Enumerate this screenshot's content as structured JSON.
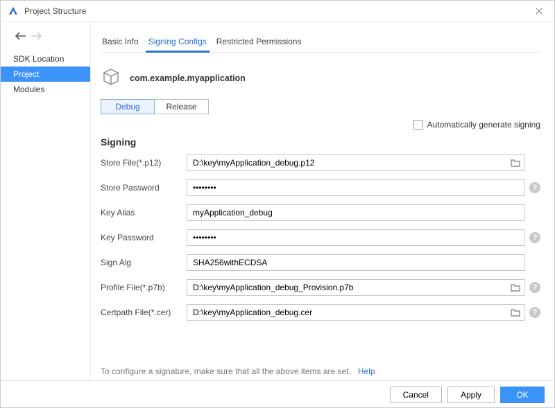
{
  "window": {
    "title": "Project Structure"
  },
  "sidebar": {
    "items": [
      {
        "label": "SDK Location"
      },
      {
        "label": "Project"
      },
      {
        "label": "Modules"
      }
    ]
  },
  "tabs": [
    {
      "label": "Basic Info"
    },
    {
      "label": "Signing Configs"
    },
    {
      "label": "Restricted Permissions"
    }
  ],
  "app": {
    "name": "com.example.myapplication"
  },
  "subtabs": [
    {
      "label": "Debug"
    },
    {
      "label": "Release"
    }
  ],
  "auto_signing_label": "Automatically generate signing",
  "section_title": "Signing",
  "fields": {
    "store_file": {
      "label": "Store File(*.p12)",
      "value": "D:\\key\\myApplication_debug.p12"
    },
    "store_password": {
      "label": "Store Password",
      "value": "••••••••"
    },
    "key_alias": {
      "label": "Key Alias",
      "value": "myApplication_debug"
    },
    "key_password": {
      "label": "Key Password",
      "value": "••••••••"
    },
    "sign_alg": {
      "label": "Sign Alg",
      "value": "SHA256withECDSA"
    },
    "profile_file": {
      "label": "Profile File(*.p7b)",
      "value": "D:\\key\\myApplication_debug_Provision.p7b"
    },
    "certpath_file": {
      "label": "Certpath File(*.cer)",
      "value": "D:\\key\\myApplication_debug.cer"
    }
  },
  "hint": {
    "text": "To configure a signature, make sure that all the above items are set.",
    "link": "Help"
  },
  "footer": {
    "cancel": "Cancel",
    "apply": "Apply",
    "ok": "OK"
  }
}
